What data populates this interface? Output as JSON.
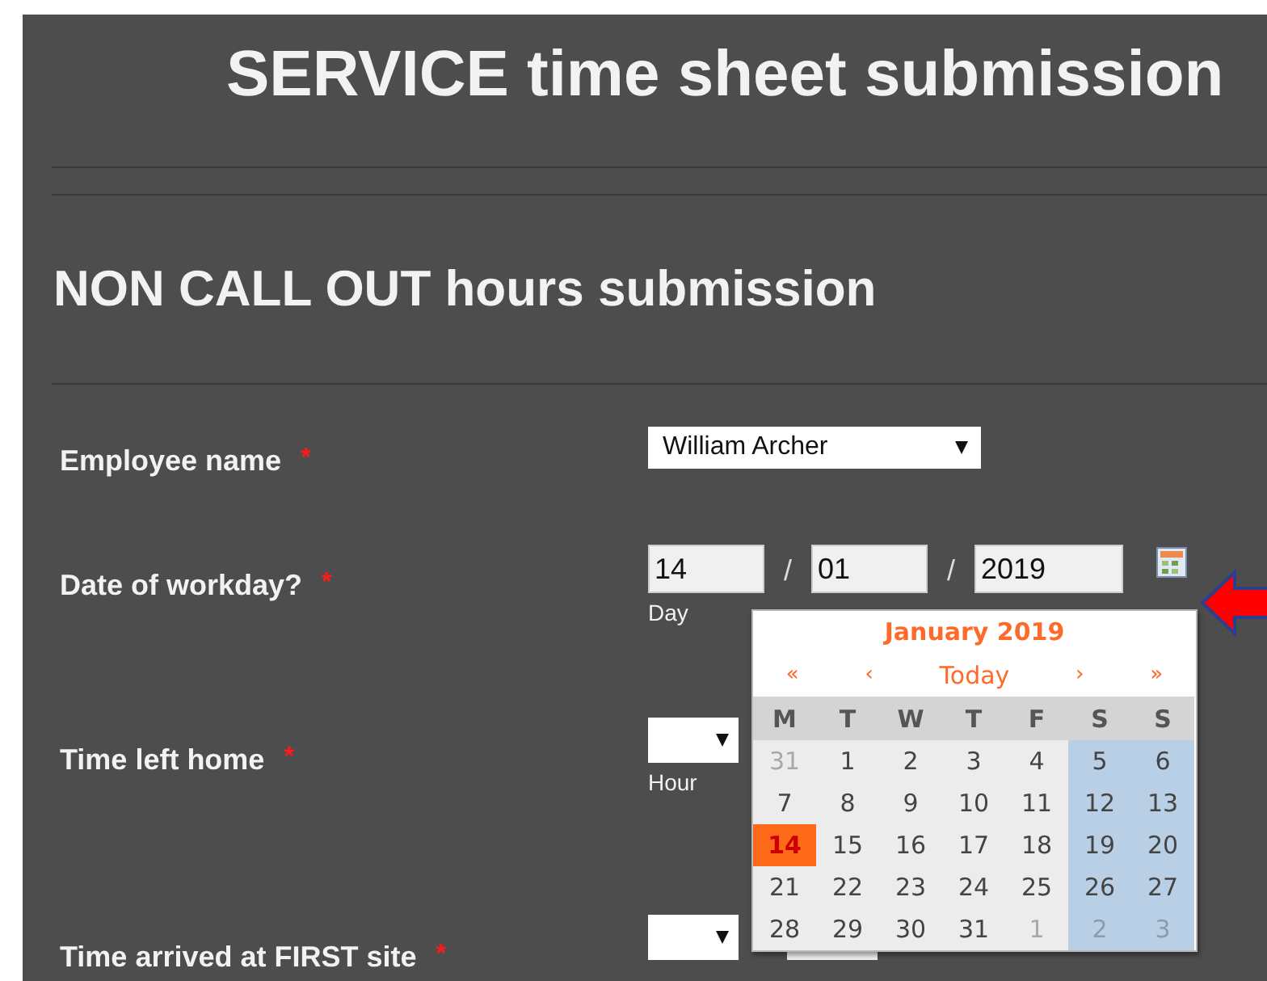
{
  "title": "SERVICE time sheet submission",
  "section_title": "NON CALL OUT hours submission",
  "fields": [
    {
      "kind": "select",
      "label": "Employee name",
      "required": "*",
      "value": "William Archer"
    },
    {
      "kind": "date",
      "label": "Date of workday?",
      "required": "*",
      "parts": [
        {
          "value": "14",
          "caption": "Day"
        },
        {
          "value": "01"
        },
        {
          "value": "2019"
        }
      ],
      "separator": "/"
    },
    {
      "kind": "time",
      "label": "Time left home",
      "required": "*",
      "hour_caption": "Hour"
    },
    {
      "kind": "time",
      "label": "Time arrived at FIRST site",
      "required": "*",
      "minutes_field": true
    }
  ],
  "calendar": {
    "month": "January 2019",
    "nav": [
      "«",
      "‹",
      "Today",
      "›",
      "»"
    ],
    "weekdays": [
      "M",
      "T",
      "W",
      "T",
      "F",
      "S",
      "S"
    ],
    "days": [
      {
        "day": "31",
        "muted": true,
        "selected": false
      },
      {
        "day": "1",
        "muted": false,
        "selected": false
      },
      {
        "day": "2",
        "muted": false,
        "selected": false
      },
      {
        "day": "3",
        "muted": false,
        "selected": false
      },
      {
        "day": "4",
        "muted": false,
        "selected": false
      },
      {
        "day": "5",
        "muted": false,
        "selected": false
      },
      {
        "day": "6",
        "muted": false,
        "selected": false
      },
      {
        "day": "7",
        "muted": false,
        "selected": false
      },
      {
        "day": "8",
        "muted": false,
        "selected": false
      },
      {
        "day": "9",
        "muted": false,
        "selected": false
      },
      {
        "day": "10",
        "muted": false,
        "selected": false
      },
      {
        "day": "11",
        "muted": false,
        "selected": false
      },
      {
        "day": "12",
        "muted": false,
        "selected": false
      },
      {
        "day": "13",
        "muted": false,
        "selected": false
      },
      {
        "day": "14",
        "muted": false,
        "selected": true
      },
      {
        "day": "15",
        "muted": false,
        "selected": false
      },
      {
        "day": "16",
        "muted": false,
        "selected": false
      },
      {
        "day": "17",
        "muted": false,
        "selected": false
      },
      {
        "day": "18",
        "muted": false,
        "selected": false
      },
      {
        "day": "19",
        "muted": false,
        "selected": false
      },
      {
        "day": "20",
        "muted": false,
        "selected": false
      },
      {
        "day": "21",
        "muted": false,
        "selected": false
      },
      {
        "day": "22",
        "muted": false,
        "selected": false
      },
      {
        "day": "23",
        "muted": false,
        "selected": false
      },
      {
        "day": "24",
        "muted": false,
        "selected": false
      },
      {
        "day": "25",
        "muted": false,
        "selected": false
      },
      {
        "day": "26",
        "muted": false,
        "selected": false
      },
      {
        "day": "27",
        "muted": false,
        "selected": false
      },
      {
        "day": "28",
        "muted": false,
        "selected": false
      },
      {
        "day": "29",
        "muted": false,
        "selected": false
      },
      {
        "day": "30",
        "muted": false,
        "selected": false
      },
      {
        "day": "31",
        "muted": false,
        "selected": false
      },
      {
        "day": "1",
        "muted": true,
        "selected": false
      },
      {
        "day": "2",
        "muted": true,
        "selected": false
      },
      {
        "day": "3",
        "muted": true,
        "selected": false
      }
    ]
  }
}
